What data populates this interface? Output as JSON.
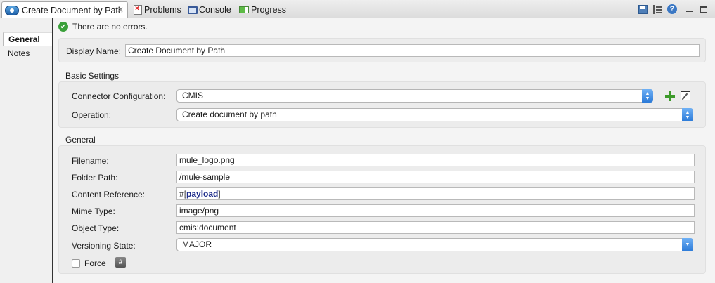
{
  "tabs": {
    "editor": {
      "label": "Create Document by Path"
    },
    "problems": {
      "label": "Problems"
    },
    "console": {
      "label": "Console"
    },
    "progress": {
      "label": "Progress"
    }
  },
  "toolbar_icons": [
    "save-icon",
    "outline-icon",
    "help-icon",
    "minimize-icon",
    "maximize-icon"
  ],
  "nav": {
    "general": "General",
    "notes": "Notes"
  },
  "status": {
    "message": "There are no errors."
  },
  "display_name": {
    "label": "Display Name:",
    "value": "Create Document by Path"
  },
  "basic_settings": {
    "title": "Basic Settings",
    "connector_label": "Connector Configuration:",
    "connector_value": "CMIS",
    "operation_label": "Operation:",
    "operation_value": "Create document by path"
  },
  "general": {
    "title": "General",
    "filename_label": "Filename:",
    "filename_value": "mule_logo.png",
    "folder_label": "Folder Path:",
    "folder_value": "/mule-sample",
    "content_label": "Content Reference:",
    "content_hash": "#",
    "content_open": "[",
    "content_key": "payload",
    "content_close": "]",
    "mime_label": "Mime Type:",
    "mime_value": "image/png",
    "object_label": "Object Type:",
    "object_value": "cmis:document",
    "versioning_label": "Versioning State:",
    "versioning_value": "MAJOR",
    "force_label": "Force",
    "force_checked": false,
    "hash_button": "#"
  },
  "colors": {
    "accent": "#2b7ad8",
    "ok": "#3aa03a",
    "add": "#3c9a2a"
  }
}
